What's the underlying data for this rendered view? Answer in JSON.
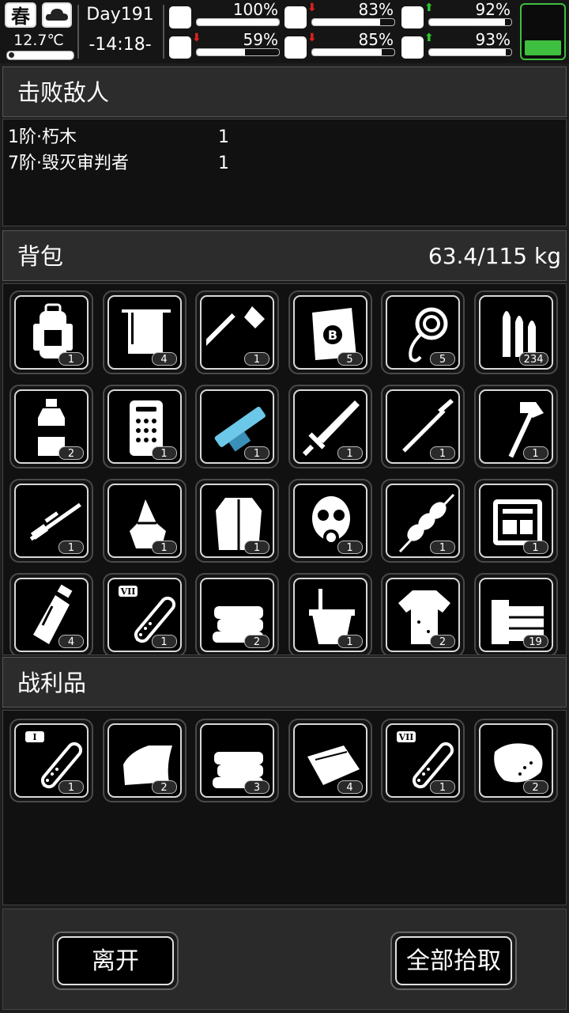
{
  "status": {
    "season": "春",
    "weather_icon": "cloudy-icon",
    "temperature": "12.7℃",
    "day": "Day191",
    "time": "-14:18-",
    "stats": [
      {
        "name": "health-icon",
        "value": "100%",
        "level": 1.0,
        "trend": ""
      },
      {
        "name": "stomach-icon",
        "value": "83%",
        "level": 0.83,
        "trend": "down"
      },
      {
        "name": "pill-icon",
        "value": "92%",
        "level": 0.92,
        "trend": "up"
      },
      {
        "name": "stamina-icon",
        "value": "59%",
        "level": 0.59,
        "trend": "down"
      },
      {
        "name": "water-icon",
        "value": "85%",
        "level": 0.85,
        "trend": "down"
      },
      {
        "name": "mood-icon",
        "value": "93%",
        "level": 0.93,
        "trend": "up"
      }
    ],
    "battery_level": 0.3,
    "battery_color": "#3fbf3f"
  },
  "defeated": {
    "title": "击败敌人",
    "enemies": [
      {
        "name": "1阶·朽木",
        "count": "1"
      },
      {
        "name": "7阶·毁灭审判者",
        "count": "1"
      }
    ]
  },
  "backpack": {
    "title": "背包",
    "weight": "63.4/115 kg",
    "items": [
      {
        "icon": "backpack-icon",
        "count": "1"
      },
      {
        "icon": "towel-rack-icon",
        "count": "4"
      },
      {
        "icon": "shovel-icon",
        "count": "1"
      },
      {
        "icon": "bag-icon",
        "count": "5"
      },
      {
        "icon": "rope-icon",
        "count": "5"
      },
      {
        "icon": "bullets-icon",
        "count": "234"
      },
      {
        "icon": "water-bottle-icon",
        "count": "2"
      },
      {
        "icon": "armor-plate-icon",
        "count": "1"
      },
      {
        "icon": "minigun-icon",
        "count": "1"
      },
      {
        "icon": "sword-icon",
        "count": "1"
      },
      {
        "icon": "spear-icon",
        "count": "1"
      },
      {
        "icon": "hammer-icon",
        "count": "1"
      },
      {
        "icon": "sniper-rifle-icon",
        "count": "1"
      },
      {
        "icon": "herbs-icon",
        "count": "1"
      },
      {
        "icon": "fur-coat-icon",
        "count": "1"
      },
      {
        "icon": "gas-mask-icon",
        "count": "1"
      },
      {
        "icon": "kebab-icon",
        "count": "1"
      },
      {
        "icon": "toolbox-icon",
        "count": "1"
      },
      {
        "icon": "milk-bottle-icon",
        "count": "4"
      },
      {
        "icon": "test-tube-icon",
        "label": "VII",
        "count": "1"
      },
      {
        "icon": "cloth-stack-icon",
        "count": "2"
      },
      {
        "icon": "bucket-icon",
        "count": "1"
      },
      {
        "icon": "ragged-shirt-icon",
        "count": "2"
      },
      {
        "icon": "wood-planks-icon",
        "count": "19"
      }
    ]
  },
  "loot": {
    "title": "战利品",
    "items": [
      {
        "icon": "test-tube-icon",
        "label": "I",
        "count": "1"
      },
      {
        "icon": "cloth-icon",
        "count": "2"
      },
      {
        "icon": "cloth-stack-icon",
        "count": "3"
      },
      {
        "icon": "fabric-icon",
        "count": "4"
      },
      {
        "icon": "test-tube-icon",
        "label": "VII",
        "count": "1"
      },
      {
        "icon": "meat-icon",
        "count": "2"
      }
    ]
  },
  "buttons": {
    "leave": "离开",
    "take_all": "全部拾取"
  }
}
